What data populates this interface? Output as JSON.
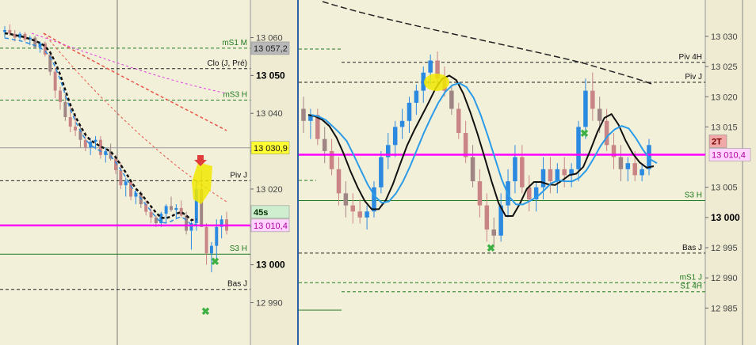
{
  "colors": {
    "plot_bg": "#f3f0da",
    "axis_bg": "#eeebd2",
    "separator": "#2b5ea6",
    "candle_up": "#2b8ae0",
    "candle_down": "#c98585",
    "candle_down_light": "#a08585",
    "pivot_magenta": "#ff00ff",
    "support_green": "#1f7a1f",
    "highlight": "#f0e800"
  },
  "chart_data": [
    {
      "type": "candlestick",
      "panel": "left",
      "ylim": [
        12985.5,
        13064.5
      ],
      "y_ticks": [
        "13 060",
        "13 050",
        "13 040",
        "13 030",
        "13 020",
        "13 010",
        "13 000",
        "12 990"
      ],
      "y_ticks_bold": [
        "13 050",
        "13 000"
      ],
      "price_labels": [
        {
          "text": "13 057,2",
          "style": "gray"
        },
        {
          "text": "13 030,9",
          "style": "yellow"
        },
        {
          "text": "45s",
          "style": "green-bold"
        },
        {
          "text": "13 010,4",
          "style": "magenta"
        }
      ],
      "levels": [
        {
          "name": "mS1 M",
          "value": 13057.2,
          "style": "green-dash"
        },
        {
          "name": "Clo (J, Pré)",
          "value": 13051.8,
          "style": "black-dash"
        },
        {
          "name": "mS3 H",
          "value": 13043.5,
          "style": "green-dash"
        },
        {
          "name": "Piv J",
          "value": 13022.2,
          "style": "black-dash"
        },
        {
          "name": "S3 H",
          "value": 13002.8,
          "style": "green-solid"
        },
        {
          "name": "Bas J",
          "value": 12993.5,
          "style": "black-dash"
        }
      ],
      "current_price": 13010.4,
      "gray_line": 13030.9,
      "candles": [
        [
          13061.5,
          13063,
          13060,
          13062
        ],
        [
          13062,
          13063.5,
          13060.5,
          13061
        ],
        [
          13061,
          13062,
          13059,
          13060
        ],
        [
          13060,
          13061.5,
          13059.5,
          13061
        ],
        [
          13061,
          13061.5,
          13059,
          13059.5
        ],
        [
          13059.5,
          13060.5,
          13058,
          13060
        ],
        [
          13060,
          13060.5,
          13057,
          13057.5
        ],
        [
          13057.5,
          13059,
          13056,
          13058.5
        ],
        [
          13058.5,
          13059,
          13055,
          13055.5
        ],
        [
          13055.5,
          13056,
          13050,
          13051
        ],
        [
          13051,
          13052,
          13044,
          13046
        ],
        [
          13046,
          13047,
          13041,
          13043
        ],
        [
          13043,
          13045,
          13038,
          13039
        ],
        [
          13039,
          13042,
          13035,
          13036.5
        ],
        [
          13036.5,
          13040,
          13034,
          13035.5
        ],
        [
          13035.5,
          13037,
          13031,
          13033
        ],
        [
          13033,
          13035,
          13030,
          13031
        ],
        [
          13031,
          13033.5,
          13029,
          13032.5
        ],
        [
          13032.5,
          13034,
          13030.5,
          13033
        ],
        [
          13033,
          13034,
          13028,
          13029
        ],
        [
          13029,
          13031,
          13027,
          13030
        ],
        [
          13030,
          13032,
          13027.5,
          13028
        ],
        [
          13028,
          13029,
          13024,
          13025
        ],
        [
          13025,
          13027,
          13020,
          13021
        ],
        [
          13021,
          13023,
          13018,
          13022
        ],
        [
          13022,
          13022.5,
          13017,
          13018
        ],
        [
          13018,
          13020,
          13016,
          13019
        ],
        [
          13019,
          13019.5,
          13015,
          13016
        ],
        [
          13016,
          13017,
          13013,
          13014
        ],
        [
          13014,
          13015.5,
          13011,
          13012.5
        ],
        [
          13012.5,
          13013,
          13010,
          13011
        ],
        [
          13011,
          13014,
          13010,
          13013.5
        ],
        [
          13013.5,
          13016,
          13011,
          13015.5
        ],
        [
          13015.5,
          13018,
          13014,
          13014.5
        ],
        [
          13014.5,
          13016,
          13012,
          13015
        ],
        [
          13015,
          13017,
          13012.5,
          13013
        ],
        [
          13013,
          13014,
          13008,
          13009
        ],
        [
          13009,
          13012,
          13004,
          13011
        ],
        [
          13011,
          13022,
          13009,
          13020
        ],
        [
          13020,
          13025,
          13015,
          13010
        ],
        [
          13010,
          13011,
          13000,
          13003
        ],
        [
          13003,
          13006,
          12998,
          13005
        ],
        [
          13005,
          13012,
          13001,
          13010
        ],
        [
          13010,
          13013,
          13007,
          13012
        ],
        [
          13012,
          13014,
          13008,
          13009
        ]
      ]
    },
    {
      "type": "candlestick",
      "panel": "right",
      "ylim": [
        12981.5,
        13035.5
      ],
      "y_ticks": [
        "13 030",
        "13 025",
        "13 020",
        "13 015",
        "13 005",
        "13 000",
        "12 995",
        "12 990",
        "12 985"
      ],
      "y_ticks_bold": [
        "13 000"
      ],
      "price_labels": [
        {
          "text": "2T",
          "style": "red-bold"
        },
        {
          "text": "13 010,4",
          "style": "magenta"
        }
      ],
      "levels": [
        {
          "name": "Piv 4H",
          "value": 13025.7,
          "style": "black-dash"
        },
        {
          "name": "Piv J",
          "value": 13022.4,
          "style": "black-dash"
        },
        {
          "name": "S3 H",
          "value": 13002.8,
          "style": "green-solid"
        },
        {
          "name": "Bas J",
          "value": 12994.1,
          "style": "black-dash"
        },
        {
          "name": "mS1 J",
          "value": 12989.2,
          "style": "green-dash"
        },
        {
          "name": "S1 4H",
          "value": 12987.7,
          "style": "green-dash"
        }
      ],
      "current_price": 13010.4,
      "candles": [
        [
          13018,
          13020,
          13014,
          13016
        ],
        [
          13016,
          13018,
          13013,
          13017
        ],
        [
          13017,
          13018,
          13012,
          13013
        ],
        [
          13013,
          13015,
          13009,
          13011
        ],
        [
          13011,
          13013,
          13007,
          13008
        ],
        [
          13008,
          13010,
          13002,
          13004
        ],
        [
          13004,
          13006,
          13000,
          13002
        ],
        [
          13002,
          13004,
          12999,
          13001
        ],
        [
          13001,
          13003,
          12999,
          13000
        ],
        [
          13000,
          13002,
          12998,
          13001
        ],
        [
          13001,
          13006,
          13000,
          13005
        ],
        [
          13005,
          13011,
          13004,
          13010
        ],
        [
          13010,
          13014,
          13008,
          13012
        ],
        [
          13012,
          13016,
          13010,
          13015
        ],
        [
          13015,
          13018,
          13013,
          13016
        ],
        [
          13016,
          13020,
          13014,
          13019
        ],
        [
          13019,
          13022,
          13017,
          13021
        ],
        [
          13021,
          13025,
          13019,
          13024
        ],
        [
          13024,
          13027,
          13022,
          13026
        ],
        [
          13026,
          13027.5,
          13022,
          13023
        ],
        [
          13023,
          13025,
          13020,
          13021
        ],
        [
          13021,
          13022,
          13017,
          13018
        ],
        [
          13018,
          13019,
          13013,
          13014
        ],
        [
          13014,
          13016,
          13009,
          13010
        ],
        [
          13010,
          13012,
          13005,
          13006
        ],
        [
          13006,
          13008,
          13000,
          13002
        ],
        [
          13002,
          13004,
          12996,
          12998
        ],
        [
          12998,
          13000,
          12995,
          12997
        ],
        [
          12997,
          13004,
          12996,
          13002
        ],
        [
          13002,
          13008,
          13000,
          13006
        ],
        [
          13006,
          13012,
          13004,
          13010
        ],
        [
          13010,
          13012,
          13004,
          13005
        ],
        [
          13005,
          13007,
          13001,
          13003
        ],
        [
          13003,
          13006,
          13001,
          13005
        ],
        [
          13005,
          13010,
          13003,
          13008
        ],
        [
          13008,
          13010,
          13004,
          13006
        ],
        [
          13006,
          13009,
          13004,
          13008
        ],
        [
          13008,
          13010,
          13005,
          13007
        ],
        [
          13007,
          13009,
          13005,
          13008
        ],
        [
          13008,
          13016,
          13006,
          13015
        ],
        [
          13015,
          13023,
          13013,
          13021
        ],
        [
          13021,
          13024,
          13016,
          13018
        ],
        [
          13018,
          13020,
          13014,
          13016
        ],
        [
          13016,
          13018,
          13011,
          13012
        ],
        [
          13012,
          13014,
          13008,
          13010
        ],
        [
          13010,
          13012,
          13006,
          13008
        ],
        [
          13008,
          13010,
          13006,
          13009
        ],
        [
          13009,
          13011,
          13006,
          13007
        ],
        [
          13007,
          13009,
          13006,
          13008
        ],
        [
          13008,
          13013,
          13007,
          13012
        ]
      ]
    }
  ]
}
